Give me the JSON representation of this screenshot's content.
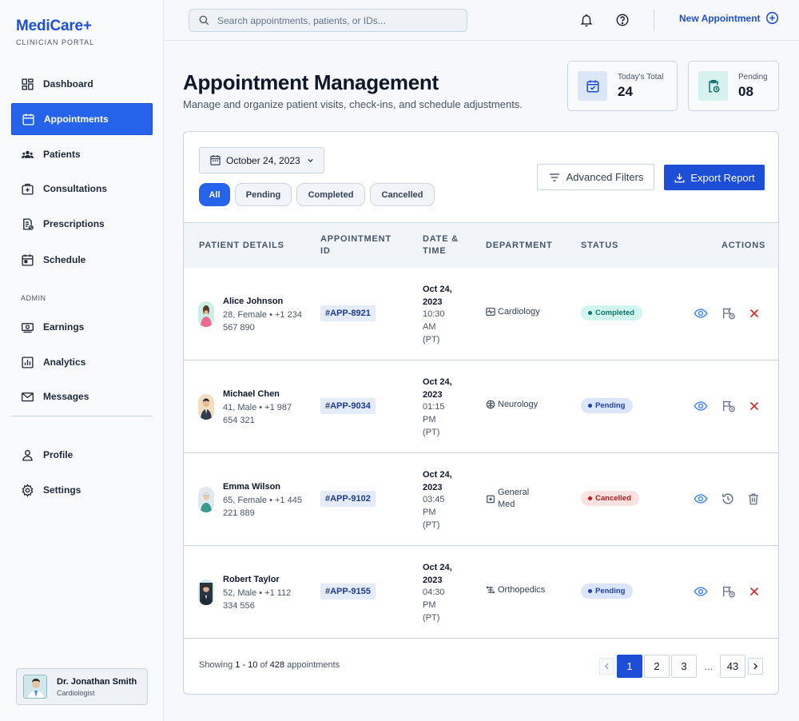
{
  "brand": {
    "name": "MediCare+",
    "subtitle": "CLINICIAN PORTAL"
  },
  "sidebar": {
    "items": [
      {
        "label": "Dashboard",
        "icon": "dashboard-icon"
      },
      {
        "label": "Appointments",
        "icon": "calendar-icon",
        "active": true
      },
      {
        "label": "Patients",
        "icon": "patients-icon"
      },
      {
        "label": "Consultations",
        "icon": "consultations-icon"
      },
      {
        "label": "Prescriptions",
        "icon": "prescriptions-icon"
      },
      {
        "label": "Schedule",
        "icon": "schedule-icon"
      }
    ],
    "admin_label": "ADMIN",
    "admin_items": [
      {
        "label": "Earnings",
        "icon": "earnings-icon"
      },
      {
        "label": "Analytics",
        "icon": "analytics-icon"
      },
      {
        "label": "Messages",
        "icon": "mail-icon"
      }
    ],
    "bottom_items": [
      {
        "label": "Profile",
        "icon": "user-icon"
      },
      {
        "label": "Settings",
        "icon": "gear-icon"
      }
    ],
    "user": {
      "name": "Dr. Jonathan Smith",
      "role": "Cardiologist"
    }
  },
  "topbar": {
    "search_placeholder": "Search appointments, patients, or IDs...",
    "new_appointment": "New Appointment"
  },
  "header": {
    "title": "Appointment Management",
    "subtitle": "Manage and organize patient visits, check-ins, and schedule adjustments."
  },
  "stats": [
    {
      "label": "Today's Total",
      "value": "24",
      "icon": "calendar-check-icon"
    },
    {
      "label": "Pending",
      "value": "08",
      "icon": "clipboard-clock-icon"
    }
  ],
  "toolbar": {
    "date": "October 24, 2023",
    "filters": [
      "All",
      "Pending",
      "Completed",
      "Cancelled"
    ],
    "active_filter": "All",
    "advanced_filters": "Advanced Filters",
    "export": "Export Report"
  },
  "table": {
    "columns": [
      "PATIENT DETAILS",
      "APPOINTMENT ID",
      "DATE & TIME",
      "DEPARTMENT",
      "STATUS",
      "ACTIONS"
    ],
    "rows": [
      {
        "name": "Alice Johnson",
        "info": "28, Female • +1 234 567 890",
        "id": "#APP-8921",
        "date": "Oct 24, 2023",
        "time": "10:30 AM (PT)",
        "department": "Cardiology",
        "dept_icon": "heart-monitor-icon",
        "status": "Completed",
        "actions": [
          "eye-icon",
          "reschedule-icon",
          "close-icon"
        ]
      },
      {
        "name": "Michael Chen",
        "info": "41, Male • +1 987 654 321",
        "id": "#APP-9034",
        "date": "Oct 24, 2023",
        "time": "01:15 PM (PT)",
        "department": "Neurology",
        "dept_icon": "brain-icon",
        "status": "Pending",
        "actions": [
          "eye-icon",
          "reschedule-icon",
          "close-icon"
        ]
      },
      {
        "name": "Emma Wilson",
        "info": "65, Female • +1 445 221 889",
        "id": "#APP-9102",
        "date": "Oct 24, 2023",
        "time": "03:45 PM (PT)",
        "department": "General Med",
        "dept_icon": "medkit-icon",
        "status": "Cancelled",
        "actions": [
          "eye-icon",
          "history-icon",
          "trash-icon"
        ]
      },
      {
        "name": "Robert Taylor",
        "info": "52, Male • +1 112 334 556",
        "id": "#APP-9155",
        "date": "Oct 24, 2023",
        "time": "04:30 PM (PT)",
        "department": "Orthopedics",
        "dept_icon": "bone-icon",
        "status": "Pending",
        "actions": [
          "eye-icon",
          "reschedule-icon",
          "close-icon"
        ]
      }
    ]
  },
  "footer": {
    "showing": "Showing",
    "range": "1 - 10",
    "of": "of",
    "total": "428",
    "suffix": "appointments",
    "pages": [
      "1",
      "2",
      "3",
      "...",
      "43"
    ],
    "current_page": "1"
  },
  "colors": {
    "accent": "#2563eb",
    "accent_dark": "#1d4ed8",
    "completed_bg": "#d1f5ef",
    "completed_fg": "#0f766e",
    "pending_bg": "#dbe5fb",
    "pending_fg": "#1e40af",
    "cancelled_bg": "#fde2e2",
    "cancelled_fg": "#b91c1c"
  }
}
